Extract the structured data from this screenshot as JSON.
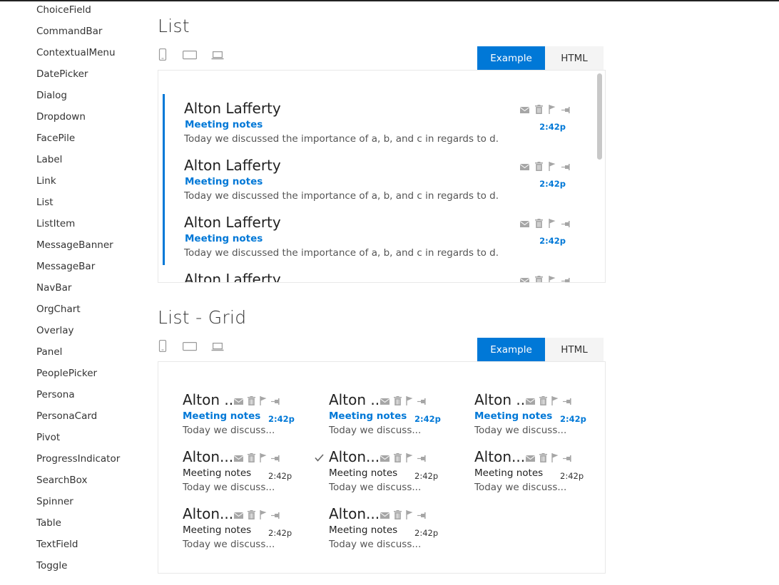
{
  "sidebar": {
    "items": [
      "ChoiceField",
      "CommandBar",
      "ContextualMenu",
      "DatePicker",
      "Dialog",
      "Dropdown",
      "FacePile",
      "Label",
      "Link",
      "List",
      "ListItem",
      "MessageBanner",
      "MessageBar",
      "NavBar",
      "OrgChart",
      "Overlay",
      "Panel",
      "PeoplePicker",
      "Persona",
      "PersonaCard",
      "Pivot",
      "ProgressIndicator",
      "SearchBox",
      "Spinner",
      "Table",
      "TextField",
      "Toggle"
    ]
  },
  "sections": {
    "list": {
      "title": "List",
      "tabs": {
        "example": "Example",
        "html": "HTML"
      },
      "items": [
        {
          "name": "Alton Lafferty",
          "subject": "Meeting notes",
          "preview": "Today we discussed the importance of a, b, and c in regards to d.",
          "time": "2:42p"
        },
        {
          "name": "Alton Lafferty",
          "subject": "Meeting notes",
          "preview": "Today we discussed the importance of a, b, and c in regards to d.",
          "time": "2:42p"
        },
        {
          "name": "Alton Lafferty",
          "subject": "Meeting notes",
          "preview": "Today we discussed the importance of a, b, and c in regards to d.",
          "time": "2:42p"
        },
        {
          "name": "Alton Lafferty",
          "subject": "",
          "preview": "",
          "time": ""
        }
      ]
    },
    "grid": {
      "title": "List - Grid",
      "tabs": {
        "example": "Example",
        "html": "HTML"
      },
      "items": [
        {
          "name": "Alton ...",
          "subject": "Meeting notes",
          "preview": "Today we discuss...",
          "time": "2:42p",
          "unread": true,
          "selected": false
        },
        {
          "name": "Alton ...",
          "subject": "Meeting notes",
          "preview": "Today we discuss...",
          "time": "2:42p",
          "unread": true,
          "selected": false
        },
        {
          "name": "Alton ...",
          "subject": "Meeting notes",
          "preview": "Today we discuss...",
          "time": "2:42p",
          "unread": true,
          "selected": false
        },
        {
          "name": "Alton...",
          "subject": "Meeting notes",
          "preview": "Today we discuss...",
          "time": "2:42p",
          "unread": false,
          "selected": false
        },
        {
          "name": "Alton...",
          "subject": "Meeting notes",
          "preview": "Today we discuss...",
          "time": "2:42p",
          "unread": false,
          "selected": true
        },
        {
          "name": "Alton...",
          "subject": "Meeting notes",
          "preview": "Today we discuss...",
          "time": "2:42p",
          "unread": false,
          "selected": false
        },
        {
          "name": "Alton...",
          "subject": "Meeting notes",
          "preview": "Today we discuss...",
          "time": "2:42p",
          "unread": false,
          "selected": false
        },
        {
          "name": "Alton...",
          "subject": "Meeting notes",
          "preview": "Today we discuss...",
          "time": "2:42p",
          "unread": false,
          "selected": false
        }
      ]
    }
  },
  "icons": {
    "devices": [
      "phone-icon",
      "tablet-icon",
      "laptop-icon"
    ],
    "actions": [
      "mail-icon",
      "trash-icon",
      "flag-icon",
      "pin-icon"
    ],
    "check": "checkmark-icon"
  },
  "colors": {
    "accent": "#0078d7",
    "tab_inactive": "#f4f4f4",
    "icon": "#a6a6a6"
  }
}
